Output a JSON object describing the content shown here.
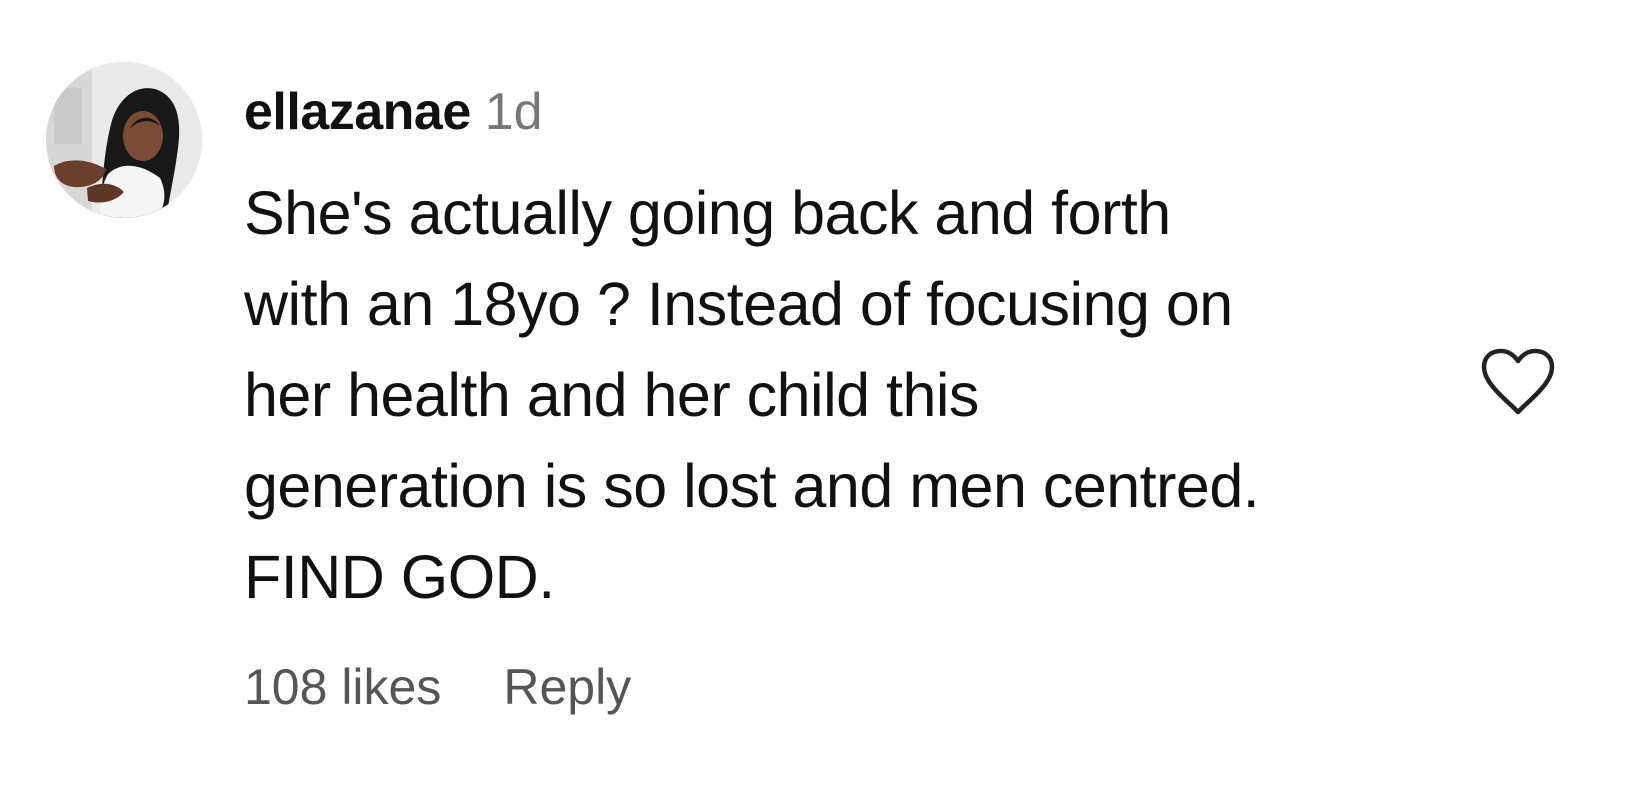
{
  "comment": {
    "username": "ellazanae",
    "timestamp": "1d",
    "text_lines": [
      "She's actually going back and forth",
      "with an 18yo ? Instead of focusing on",
      "her health and her child this",
      "generation is so lost and men centred.",
      "FIND GOD."
    ],
    "likes": "108 likes",
    "reply_label": "Reply",
    "like_icon": "heart-outline-icon",
    "avatar_icon": "user-avatar"
  },
  "colors": {
    "background": "#ffffff",
    "username": "#111111",
    "body_text": "#111111",
    "timestamp": "#777777",
    "meta_text": "#555555",
    "heart_stroke": "#222222"
  }
}
